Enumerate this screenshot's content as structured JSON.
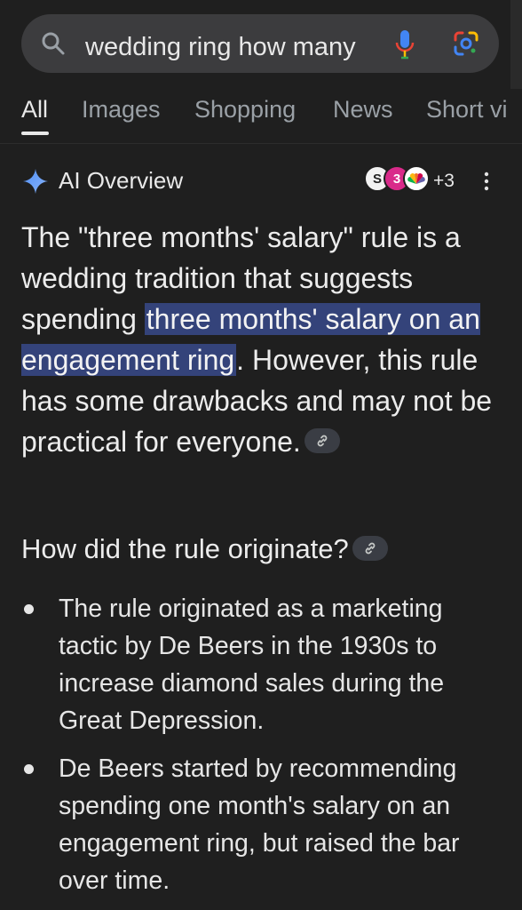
{
  "search": {
    "query": "wedding ring how many",
    "icons": {
      "search": "search-icon",
      "mic": "mic-icon",
      "lens": "google-lens-icon"
    }
  },
  "tabs": [
    {
      "label": "All",
      "active": true
    },
    {
      "label": "Images",
      "active": false
    },
    {
      "label": "Shopping",
      "active": false
    },
    {
      "label": "News",
      "active": false
    },
    {
      "label": "Short vi",
      "active": false
    }
  ],
  "ai_overview": {
    "title": "AI Overview",
    "source_favicons": [
      "S",
      "3",
      ""
    ],
    "more_sources": "+3",
    "paragraph": {
      "before": "The \"three months' salary\" rule is a wedding tradition that suggests spending ",
      "highlight": "three months' salary on an engagement ring",
      "after": ". However, this rule has some drawbacks and may not be practical for everyone."
    },
    "section_heading": "How did the rule originate?",
    "bullets": [
      "The rule originated as a marketing tactic by De Beers in the 1930s to increase diamond sales during the Great Depression.",
      "De Beers started by recommending spending one month's salary on an engagement ring, but raised the bar over time."
    ]
  },
  "colors": {
    "background": "#1f1f1f",
    "search_bar": "#3c3c3e",
    "highlight": "#34437a",
    "muted_text": "#9aa0a6",
    "mic_blue": "#4285f4",
    "mic_red": "#ea4335"
  }
}
